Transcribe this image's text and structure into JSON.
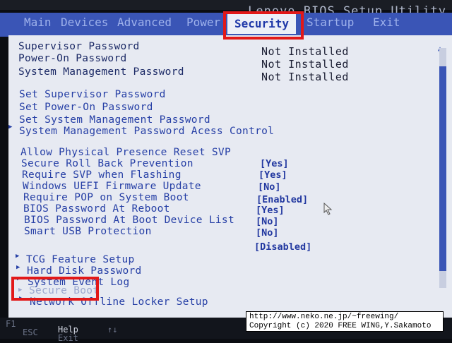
{
  "window": {
    "title": "Lenovo BIOS Setup Utility"
  },
  "menu": {
    "tabs": [
      "Main",
      "Devices",
      "Advanced",
      "Power",
      "Security",
      "Startup",
      "Exit"
    ],
    "active": "Security"
  },
  "passwords": [
    {
      "label": "Supervisor Password",
      "value": "Not Installed"
    },
    {
      "label": "Power-On Password",
      "value": "Not Installed"
    },
    {
      "label": "System Management Password",
      "value": "Not Installed"
    }
  ],
  "set_items": [
    "Set Supervisor Password",
    "Set Power-On Password",
    "Set System Management Password",
    "System Management Password Acess Control"
  ],
  "options": [
    {
      "label": "Allow Physical  Presence Reset SVP",
      "value": "[Yes]"
    },
    {
      "label": "Secure Roll Back Prevention",
      "value": "[Yes]"
    },
    {
      "label": "Require SVP when Flashing",
      "value": "[No]"
    },
    {
      "label": "Windows UEFI Firmware Update",
      "value": "[Enabled]"
    },
    {
      "label": "Require POP on System Boot",
      "value": "[Yes]"
    },
    {
      "label": "BIOS Password At Reboot",
      "value": "[No]"
    },
    {
      "label": "BIOS Password At Boot Device List",
      "value": "[No]"
    },
    {
      "label": "Smart USB Protection",
      "value": "[Disabled]"
    }
  ],
  "submenus": [
    "TCG Feature Setup",
    "Hard Disk Password",
    "System Event Log",
    "Secure Boot",
    "Network Offline Locker Setup"
  ],
  "footer": {
    "f1": "F1",
    "esc": "ESC",
    "help": "Help",
    "exit": "Exit",
    "arrows": "↑↓"
  },
  "copyright": {
    "line1": "http://www.neko.ne.jp/~freewing/",
    "line2": "Copyright (c) 2020 FREE WING,Y.Sakamoto"
  },
  "colors": {
    "accent": "#3a55b6",
    "highlight": "#e21818",
    "panel": "#e7eaf2"
  }
}
